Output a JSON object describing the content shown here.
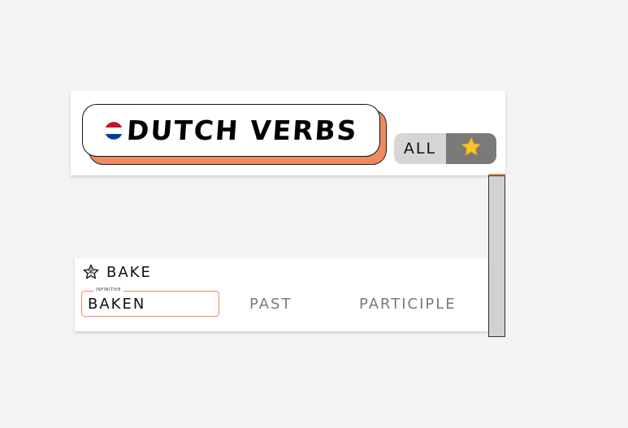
{
  "header": {
    "title": "DUTCH VERBS",
    "flag_icon": "netherlands-flag-icon",
    "filter": {
      "all_label": "ALL",
      "star_icon": "star-icon"
    }
  },
  "verbs": [
    {
      "english": "BAKE",
      "favorite_icon": "star-outline-icon",
      "infinitive_label": "INFINITIVE",
      "infinitive_value": "BAKEN",
      "past_placeholder": "PAST",
      "participle_placeholder": "PARTICIPLE"
    }
  ],
  "colors": {
    "accent": "#ef8a63",
    "background": "#f3f3f3",
    "toggle_all_bg": "#d6d6d6",
    "toggle_star_bg": "#7a7a7a",
    "star_gold": "#f7c532"
  }
}
